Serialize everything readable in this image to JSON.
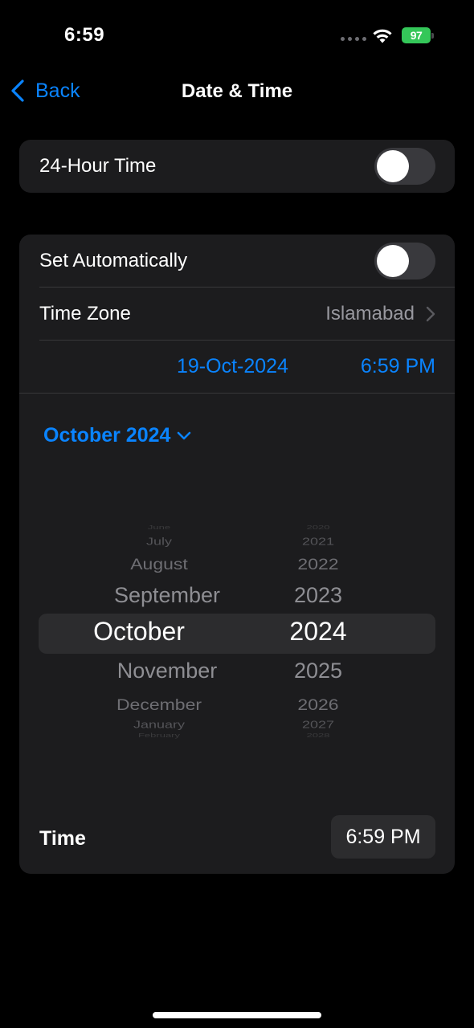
{
  "status_bar": {
    "time": "6:59",
    "battery": "97",
    "icons": [
      "signal-dots-icon",
      "wifi-icon",
      "battery-charging-icon"
    ]
  },
  "nav": {
    "back_label": "Back",
    "title": "Date & Time"
  },
  "settings": {
    "hour24_label": "24-Hour Time",
    "hour24_on": false,
    "set_auto_label": "Set Automatically",
    "set_auto_on": false,
    "timezone_label": "Time Zone",
    "timezone_value": "Islamabad",
    "date_value": "19-Oct-2024",
    "time_value": "6:59 PM"
  },
  "calendar": {
    "month_header": "October 2024",
    "months": [
      "June",
      "July",
      "August",
      "September",
      "October",
      "November",
      "December",
      "January",
      "February"
    ],
    "years": [
      "2020",
      "2021",
      "2022",
      "2023",
      "2024",
      "2025",
      "2026",
      "2027",
      "2028"
    ],
    "selected_index": 4
  },
  "time_picker": {
    "label": "Time",
    "value": "6:59 PM"
  },
  "colors": {
    "accent": "#0a84ff",
    "background": "#000000",
    "group_bg": "#1c1c1e",
    "battery": "#34c759"
  }
}
